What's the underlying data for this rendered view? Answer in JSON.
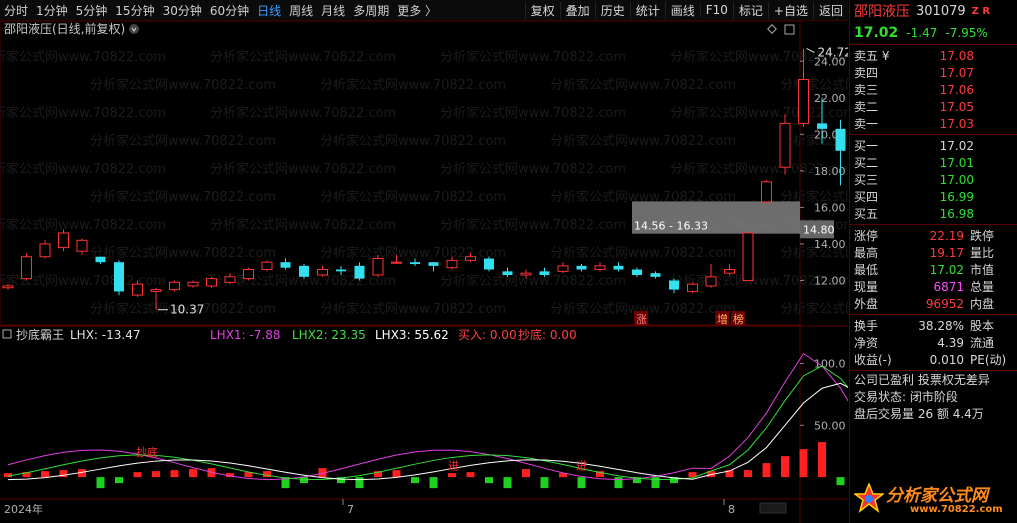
{
  "toolbar": {
    "periods": [
      "分时",
      "1分钟",
      "5分钟",
      "15分钟",
      "30分钟",
      "60分钟",
      "日线",
      "周线",
      "月线",
      "多周期",
      "更多 〉"
    ],
    "active_period": "日线",
    "actions": [
      "复权",
      "叠加",
      "历史",
      "统计",
      "画线",
      "F10",
      "标记",
      "+自选",
      "返回"
    ]
  },
  "chart_title": "邵阳液压(日线,前复权)",
  "watermark": "分析家公式网www.70822.com",
  "main": {
    "y_ticks": [
      "24.00",
      "22.00",
      "20.00",
      "18.00",
      "16.00",
      "14.00",
      "12.00"
    ],
    "high_label": "24.72",
    "low_label": "10.37",
    "current_price_tag": "14.80",
    "gap_label": "14.56 - 16.33",
    "markers": [
      "涨",
      "增",
      "榜"
    ]
  },
  "indicator": {
    "name": "抄底霸王",
    "lhx": "LHX: -13.47",
    "lhx1": "LHX1: -7.88",
    "lhx2": "LHX2: 23.35",
    "lhx3": "LHX3: 55.62",
    "buy": "买入: 0.00",
    "bottom": "抄底: 0.00",
    "y_ticks": [
      "100.0",
      "50.00"
    ],
    "signals": [
      "抄底",
      "进",
      "进"
    ]
  },
  "x_axis": [
    "2024年",
    "7",
    "8"
  ],
  "quote": {
    "name": "邵阳液压",
    "code": "301079",
    "badge": "Z R",
    "price": "17.02",
    "change": "-1.47",
    "change_pct": "-7.95%",
    "asks": [
      {
        "label": "卖五 ¥",
        "price": "17.08"
      },
      {
        "label": "卖四",
        "price": "17.07"
      },
      {
        "label": "卖三",
        "price": "17.06"
      },
      {
        "label": "卖二",
        "price": "17.05"
      },
      {
        "label": "卖一",
        "price": "17.03"
      }
    ],
    "bids": [
      {
        "label": "买一",
        "price": "17.02"
      },
      {
        "label": "买二",
        "price": "17.01"
      },
      {
        "label": "买三",
        "price": "17.00"
      },
      {
        "label": "买四",
        "price": "16.99"
      },
      {
        "label": "买五",
        "price": "16.98"
      }
    ],
    "stats1": [
      {
        "l": "涨停",
        "v": "22.19",
        "r": "跌停",
        "c": "r2"
      },
      {
        "l": "最高",
        "v": "19.17",
        "r": "量比",
        "c": "r2"
      },
      {
        "l": "最低",
        "v": "17.02",
        "r": "市值",
        "c": "g2"
      },
      {
        "l": "现量",
        "v": "6871",
        "r": "总量",
        "c": "m2"
      },
      {
        "l": "外盘",
        "v": "96952",
        "r": "内盘",
        "c": "r2"
      }
    ],
    "stats2": [
      {
        "l": "换手",
        "v": "38.28%",
        "r": "股本"
      },
      {
        "l": "净资",
        "v": "4.39",
        "r": "流通"
      },
      {
        "l": "收益(-)",
        "v": "0.010",
        "r": "PE(动)"
      }
    ],
    "notes": [
      "公司已盈利 投票权无差异",
      "交易状态: 闭市阶段",
      "盘后交易量 26 额 4.4万"
    ]
  },
  "logo": {
    "text": "分析家公式网",
    "url": "www.70822.com"
  },
  "colors": {
    "up": "#ff3333",
    "down": "#33e0f0",
    "lhx1": "#e040e0",
    "lhx2": "#33e033",
    "lhx3": "#ffffff",
    "gap": "#808080"
  },
  "chart_data": {
    "type": "candlestick",
    "ylim": [
      10,
      25
    ],
    "candles": [
      [
        11.6,
        11.7,
        11.5,
        11.8
      ],
      [
        12.1,
        13.3,
        12.0,
        13.5
      ],
      [
        13.3,
        14.0,
        13.2,
        14.2
      ],
      [
        13.8,
        14.6,
        13.6,
        14.8
      ],
      [
        13.6,
        14.2,
        13.4,
        14.3
      ],
      [
        13.3,
        13.0,
        12.9,
        13.3
      ],
      [
        13.0,
        11.4,
        11.2,
        13.1
      ],
      [
        11.2,
        11.8,
        11.1,
        12.0
      ],
      [
        11.4,
        11.5,
        10.4,
        11.6
      ],
      [
        11.5,
        11.9,
        11.4,
        12.0
      ],
      [
        11.7,
        11.9,
        11.6,
        12.0
      ],
      [
        11.7,
        12.1,
        11.6,
        12.2
      ],
      [
        11.9,
        12.2,
        11.8,
        12.4
      ],
      [
        12.1,
        12.6,
        12.0,
        12.7
      ],
      [
        12.6,
        13.0,
        12.5,
        13.1
      ],
      [
        13.0,
        12.7,
        12.6,
        13.2
      ],
      [
        12.8,
        12.2,
        12.1,
        12.9
      ],
      [
        12.3,
        12.6,
        12.2,
        12.8
      ],
      [
        12.6,
        12.5,
        12.3,
        12.8
      ],
      [
        12.8,
        12.1,
        12.0,
        13.0
      ],
      [
        12.3,
        13.2,
        12.2,
        13.4
      ],
      [
        13.0,
        13.0,
        12.9,
        13.4
      ],
      [
        13.0,
        12.9,
        12.8,
        13.2
      ],
      [
        13.0,
        12.8,
        12.5,
        13.0
      ],
      [
        12.7,
        13.1,
        12.6,
        13.3
      ],
      [
        13.1,
        13.3,
        13.0,
        13.5
      ],
      [
        13.2,
        12.6,
        12.5,
        13.3
      ],
      [
        12.5,
        12.3,
        12.2,
        12.7
      ],
      [
        12.3,
        12.4,
        12.1,
        12.6
      ],
      [
        12.5,
        12.3,
        12.2,
        12.7
      ],
      [
        12.5,
        12.8,
        12.4,
        13.0
      ],
      [
        12.8,
        12.6,
        12.5,
        12.9
      ],
      [
        12.6,
        12.8,
        12.5,
        13.0
      ],
      [
        12.8,
        12.6,
        12.5,
        13.0
      ],
      [
        12.6,
        12.3,
        12.2,
        12.7
      ],
      [
        12.4,
        12.2,
        12.1,
        12.5
      ],
      [
        12.0,
        11.5,
        11.3,
        12.1
      ],
      [
        11.4,
        11.8,
        11.3,
        11.9
      ],
      [
        11.7,
        12.2,
        11.6,
        12.9
      ],
      [
        12.4,
        12.6,
        12.3,
        12.9
      ],
      [
        12.0,
        14.6,
        12.0,
        14.6
      ],
      [
        16.3,
        17.4,
        16.3,
        17.5
      ],
      [
        18.2,
        20.6,
        17.8,
        21.1
      ],
      [
        20.6,
        23.0,
        20.4,
        24.7
      ],
      [
        20.6,
        20.3,
        19.5,
        22.0
      ],
      [
        20.3,
        19.1,
        17.2,
        20.8
      ],
      [
        19.4,
        18.6,
        17.5,
        19.9
      ],
      [
        18.5,
        17.0,
        17.0,
        19.2
      ]
    ]
  }
}
